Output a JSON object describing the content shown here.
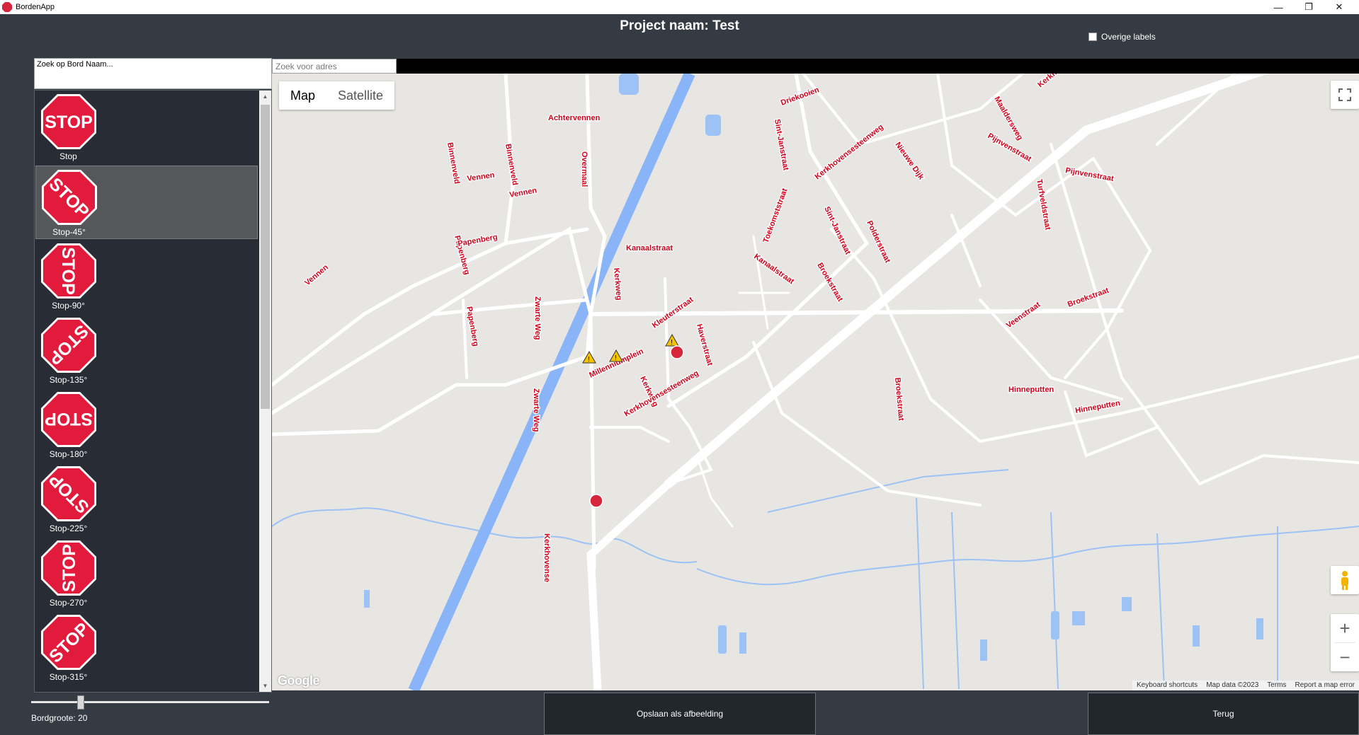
{
  "window": {
    "title": "BordenApp",
    "minimize": "—",
    "restore": "❐",
    "close": "✕"
  },
  "header": {
    "title": "Project naam: Test"
  },
  "labels_toggle": {
    "label": "Overige labels",
    "checked": false
  },
  "sign_search": {
    "placeholder": "Zoek op Bord Naam..."
  },
  "signs": [
    {
      "label": "Stop",
      "rotation": 0,
      "selected": false
    },
    {
      "label": "Stop-45°",
      "rotation": 45,
      "selected": true
    },
    {
      "label": "Stop-90°",
      "rotation": 90,
      "selected": false
    },
    {
      "label": "Stop-135°",
      "rotation": 135,
      "selected": false
    },
    {
      "label": "Stop-180°",
      "rotation": 180,
      "selected": false
    },
    {
      "label": "Stop-225°",
      "rotation": 225,
      "selected": false
    },
    {
      "label": "Stop-270°",
      "rotation": 270,
      "selected": false
    },
    {
      "label": "Stop-315°",
      "rotation": 315,
      "selected": false
    }
  ],
  "sign_text": "STOP",
  "size": {
    "label": "Bordgroote:",
    "value": "20",
    "level": 0.2
  },
  "address_search": {
    "placeholder": "Zoek voor adres"
  },
  "map": {
    "type_buttons": [
      "Map",
      "Satellite"
    ],
    "active_type": "Map",
    "zoom_in": "+",
    "zoom_out": "−",
    "logo": "Google",
    "attribution": [
      "Keyboard shortcuts",
      "Map data ©2023",
      "Terms",
      "Report a map error"
    ],
    "street_labels": [
      "Binnenveld",
      "Achtervennen",
      "Overmaal",
      "Vennen",
      "Papenberg",
      "Papenberg",
      "Papenberg",
      "Vennen",
      "Kanaalstraat",
      "Kanaalstraat",
      "Kerkweg",
      "Kerkweg",
      "Kleuterstraat",
      "Haverstraat",
      "Millenniumplein",
      "Zwarte Weg",
      "Zwarte Weg",
      "Kerkhovensesteenweg",
      "Kerkhovensesteenweg",
      "Kerkhovense",
      "Toekomststraat",
      "Sint-Janstraat",
      "Sint-Janstraat",
      "Driekooien",
      "Nieuwe Dijk",
      "Maaldersweg",
      "Pijnvenstraat",
      "Pijnvenstraat",
      "Turfveldstraat",
      "Polderstraat",
      "Broekstraat",
      "Broekstraat",
      "Broekstraat",
      "Veenstraat",
      "Hinneputten",
      "Hinneputten",
      "Kerkhove",
      "Binnenveld",
      "Vennen"
    ],
    "colors": {
      "road": "#ffffff",
      "label": "#d0021b",
      "land": "#e8e6e3",
      "water": "#9dc2f5",
      "canal": "#8ab4f8"
    }
  },
  "buttons": {
    "save": "Opslaan als afbeelding",
    "back": "Terug"
  }
}
